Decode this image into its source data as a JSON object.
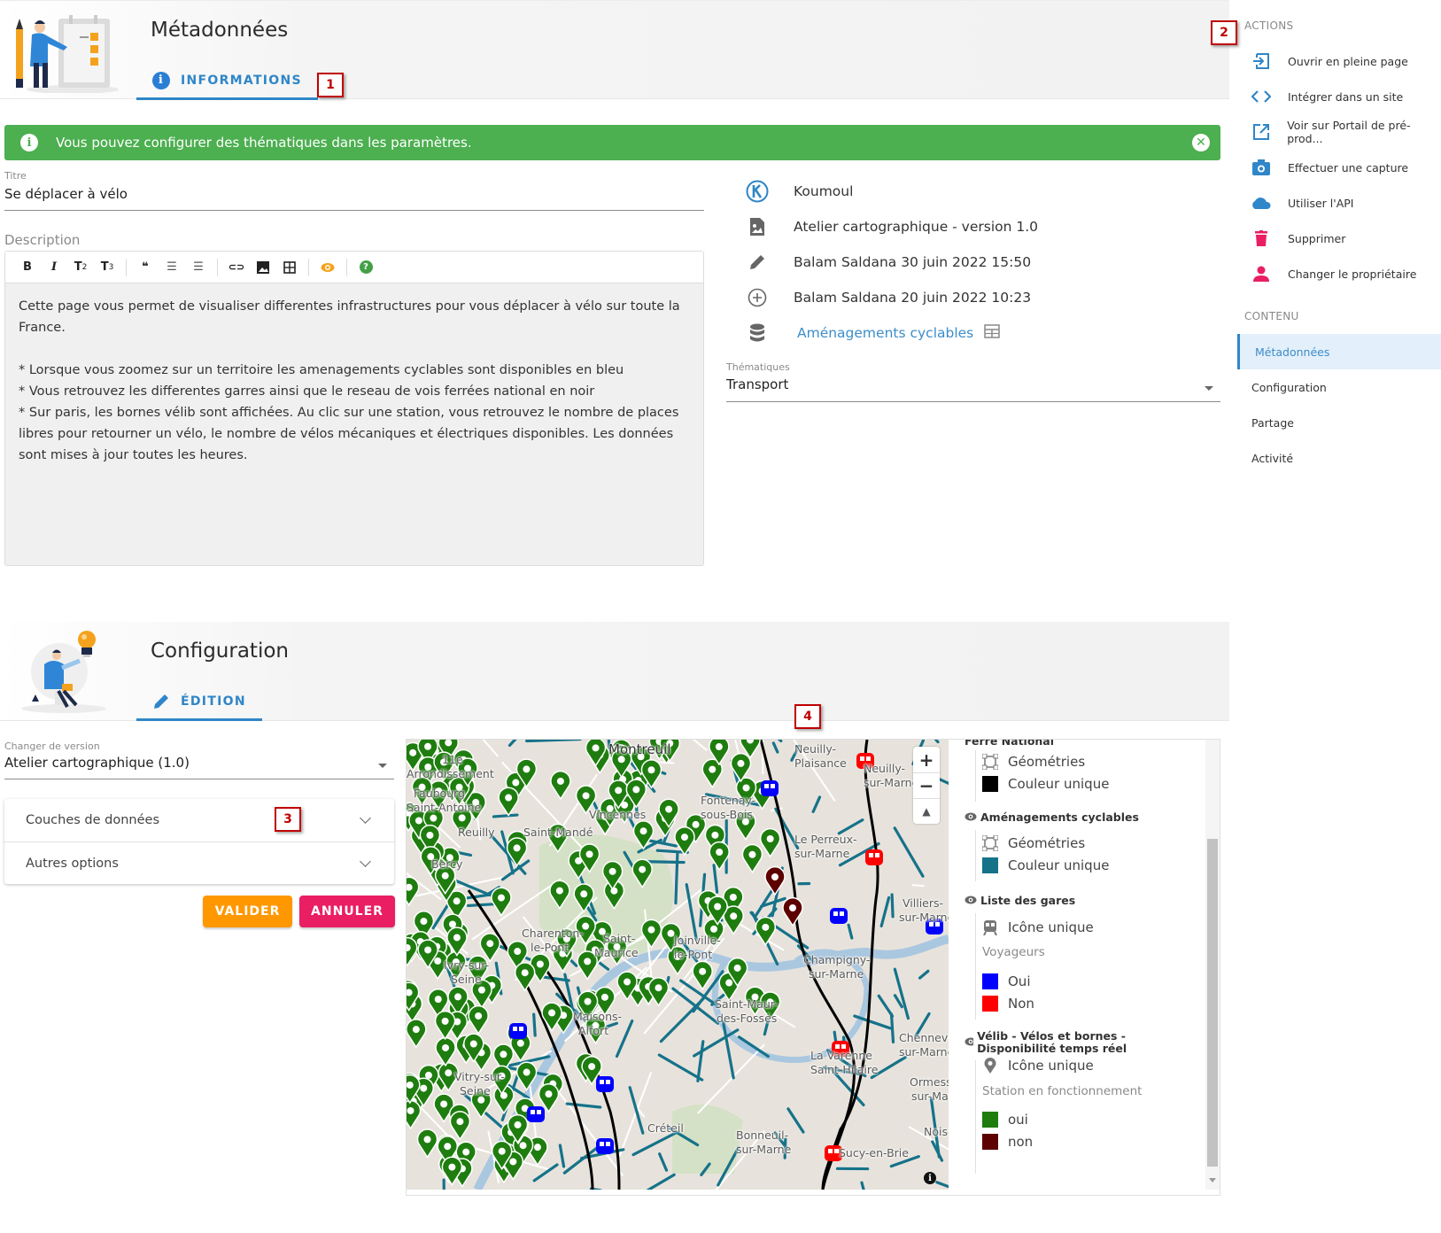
{
  "metadata_section": {
    "title": "Métadonnées",
    "tab_label": "INFORMATIONS",
    "marker": "1"
  },
  "alert": {
    "message": "Vous pouvez configurer des thématiques dans les paramètres.",
    "color": "#4caf50"
  },
  "title_field": {
    "label": "Titre",
    "value": "Se déplacer à vélo"
  },
  "description": {
    "label": "Description",
    "toolbar": {
      "bold": "B",
      "italic": "I",
      "h2": "T",
      "h2_sub": "2",
      "h3": "T",
      "h3_sub": "3",
      "quote": "❝",
      "bullet_list": "☰",
      "numbered_list": "☰",
      "link": "⊂⊃",
      "image": "▣",
      "table": "⊞",
      "preview": "◉",
      "help": "?"
    },
    "text": "Cette page vous permet de visualiser differentes infrastructures pour vous déplacer à vélo sur toute la France.\n\n* Lorsque vous zoomez sur un territoire les amenagements cyclables sont disponibles en bleu\n* Vous retrouvez les differentes garres ainsi que le reseau de vois ferrées national en noir\n* Sur paris, les bornes vélib sont affichées. Au clic sur une station, vous retrouvez le nombre de places libres pour retourner un vélo, le nombre de vélos mécaniques et électriques disponibles. Les données sont mises à jour toutes les heures."
  },
  "info_panel": {
    "owner": "Koumoul",
    "application": "Atelier cartographique - version 1.0",
    "updated": "Balam Saldana 30 juin 2022 15:50",
    "created": "Balam Saldana 20 juin 2022 10:23",
    "dataset_link": "Aménagements cyclables",
    "topics_label": "Thématiques",
    "topics_value": "Transport"
  },
  "sidebar": {
    "marker": "2",
    "actions_heading": "ACTIONS",
    "actions": [
      {
        "label": "Ouvrir en pleine page",
        "icon": "open-in-page-icon",
        "color": "#2f86c8"
      },
      {
        "label": "Intégrer dans un site",
        "icon": "code-icon",
        "color": "#2f86c8"
      },
      {
        "label": "Voir sur Portail de pré-prod...",
        "icon": "external-link-icon",
        "color": "#2f86c8"
      },
      {
        "label": "Effectuer une capture",
        "icon": "camera-icon",
        "color": "#2f86c8"
      },
      {
        "label": "Utiliser l'API",
        "icon": "cloud-icon",
        "color": "#2f86c8"
      },
      {
        "label": "Supprimer",
        "icon": "trash-icon",
        "color": "#e91e63"
      },
      {
        "label": "Changer le propriétaire",
        "icon": "person-icon",
        "color": "#e91e63"
      }
    ],
    "content_heading": "CONTENU",
    "content_items": [
      {
        "label": "Métadonnées",
        "active": true
      },
      {
        "label": "Configuration",
        "active": false
      },
      {
        "label": "Partage",
        "active": false
      },
      {
        "label": "Activité",
        "active": false
      }
    ]
  },
  "configuration_section": {
    "title": "Configuration",
    "tab_label": "ÉDITION",
    "version_label": "Changer de version",
    "version_value": "Atelier cartographique (1.0)",
    "accordion": [
      {
        "label": "Couches de données",
        "marker": "3"
      },
      {
        "label": "Autres options"
      }
    ],
    "validate_label": "VALIDER",
    "cancel_label": "ANNULER",
    "map_marker": "4"
  },
  "map": {
    "zoom_in": "+",
    "zoom_out": "−",
    "reset_north": "▲",
    "info": "i",
    "places": [
      "Montreuil",
      "11e",
      "Arrondissement",
      "Faubourg",
      "Saint-Antoine",
      "Reuilly",
      "Bercy",
      "Saint-Mandé",
      "Vincennes",
      "Fontenay-",
      "sous-Bois",
      "Neuilly-",
      "Plaisance",
      "Neuilly-",
      "sur-Marne",
      "Le Perreux-",
      "sur-Marne",
      "Villiers-",
      "sur-Marne",
      "Charenton-",
      "le-Pont",
      "Saint-",
      "Maurice",
      "Joinville-",
      "le-Pont",
      "Champigny-",
      "sur-Marne",
      "Ivry-sur-",
      "Seine",
      "Maisons-",
      "Alfort",
      "Saint-Maur-",
      "des-Fossés",
      "Vitry-sur-",
      "Seine",
      "Créteil",
      "La Varenne",
      "Saint-Hilaire",
      "Chennevières-",
      "sur-Marne",
      "Ormesson-",
      "sur-Marne",
      "Bonneuil-",
      "sur-Marne",
      "Sucy-en-Brie",
      "Noiseau"
    ]
  },
  "legend": {
    "groups": [
      {
        "title": "Ferré National",
        "items": [
          {
            "label": "Géométries",
            "type": "geometry"
          },
          {
            "label": "Couleur unique",
            "color": "#000000"
          }
        ]
      },
      {
        "title": "Aménagements cyclables",
        "items": [
          {
            "label": "Géométries",
            "type": "geometry"
          },
          {
            "label": "Couleur unique",
            "color": "#167289"
          }
        ]
      },
      {
        "title": "Liste des gares",
        "items": [
          {
            "label": "Icône unique",
            "type": "train"
          }
        ],
        "sub_title": "Voyageurs",
        "sub_items": [
          {
            "label": "Oui",
            "color": "#0000ff"
          },
          {
            "label": "Non",
            "color": "#ff0000"
          }
        ]
      },
      {
        "title": "Vélib - Vélos et bornes - Disponibilité temps réel",
        "items": [
          {
            "label": "Icône unique",
            "type": "pin"
          }
        ],
        "sub_title": "Station en fonctionnement",
        "sub_items": [
          {
            "label": "oui",
            "color": "#1e7d0e"
          },
          {
            "label": "non",
            "color": "#5c0000"
          }
        ]
      }
    ]
  },
  "colors": {
    "primary": "#2f86c8",
    "success": "#4caf50",
    "warning": "#ff9800",
    "danger": "#e91e63",
    "bike_lanes": "#167289",
    "velib_ok": "#1e7d0e",
    "velib_ko": "#5c0000"
  }
}
